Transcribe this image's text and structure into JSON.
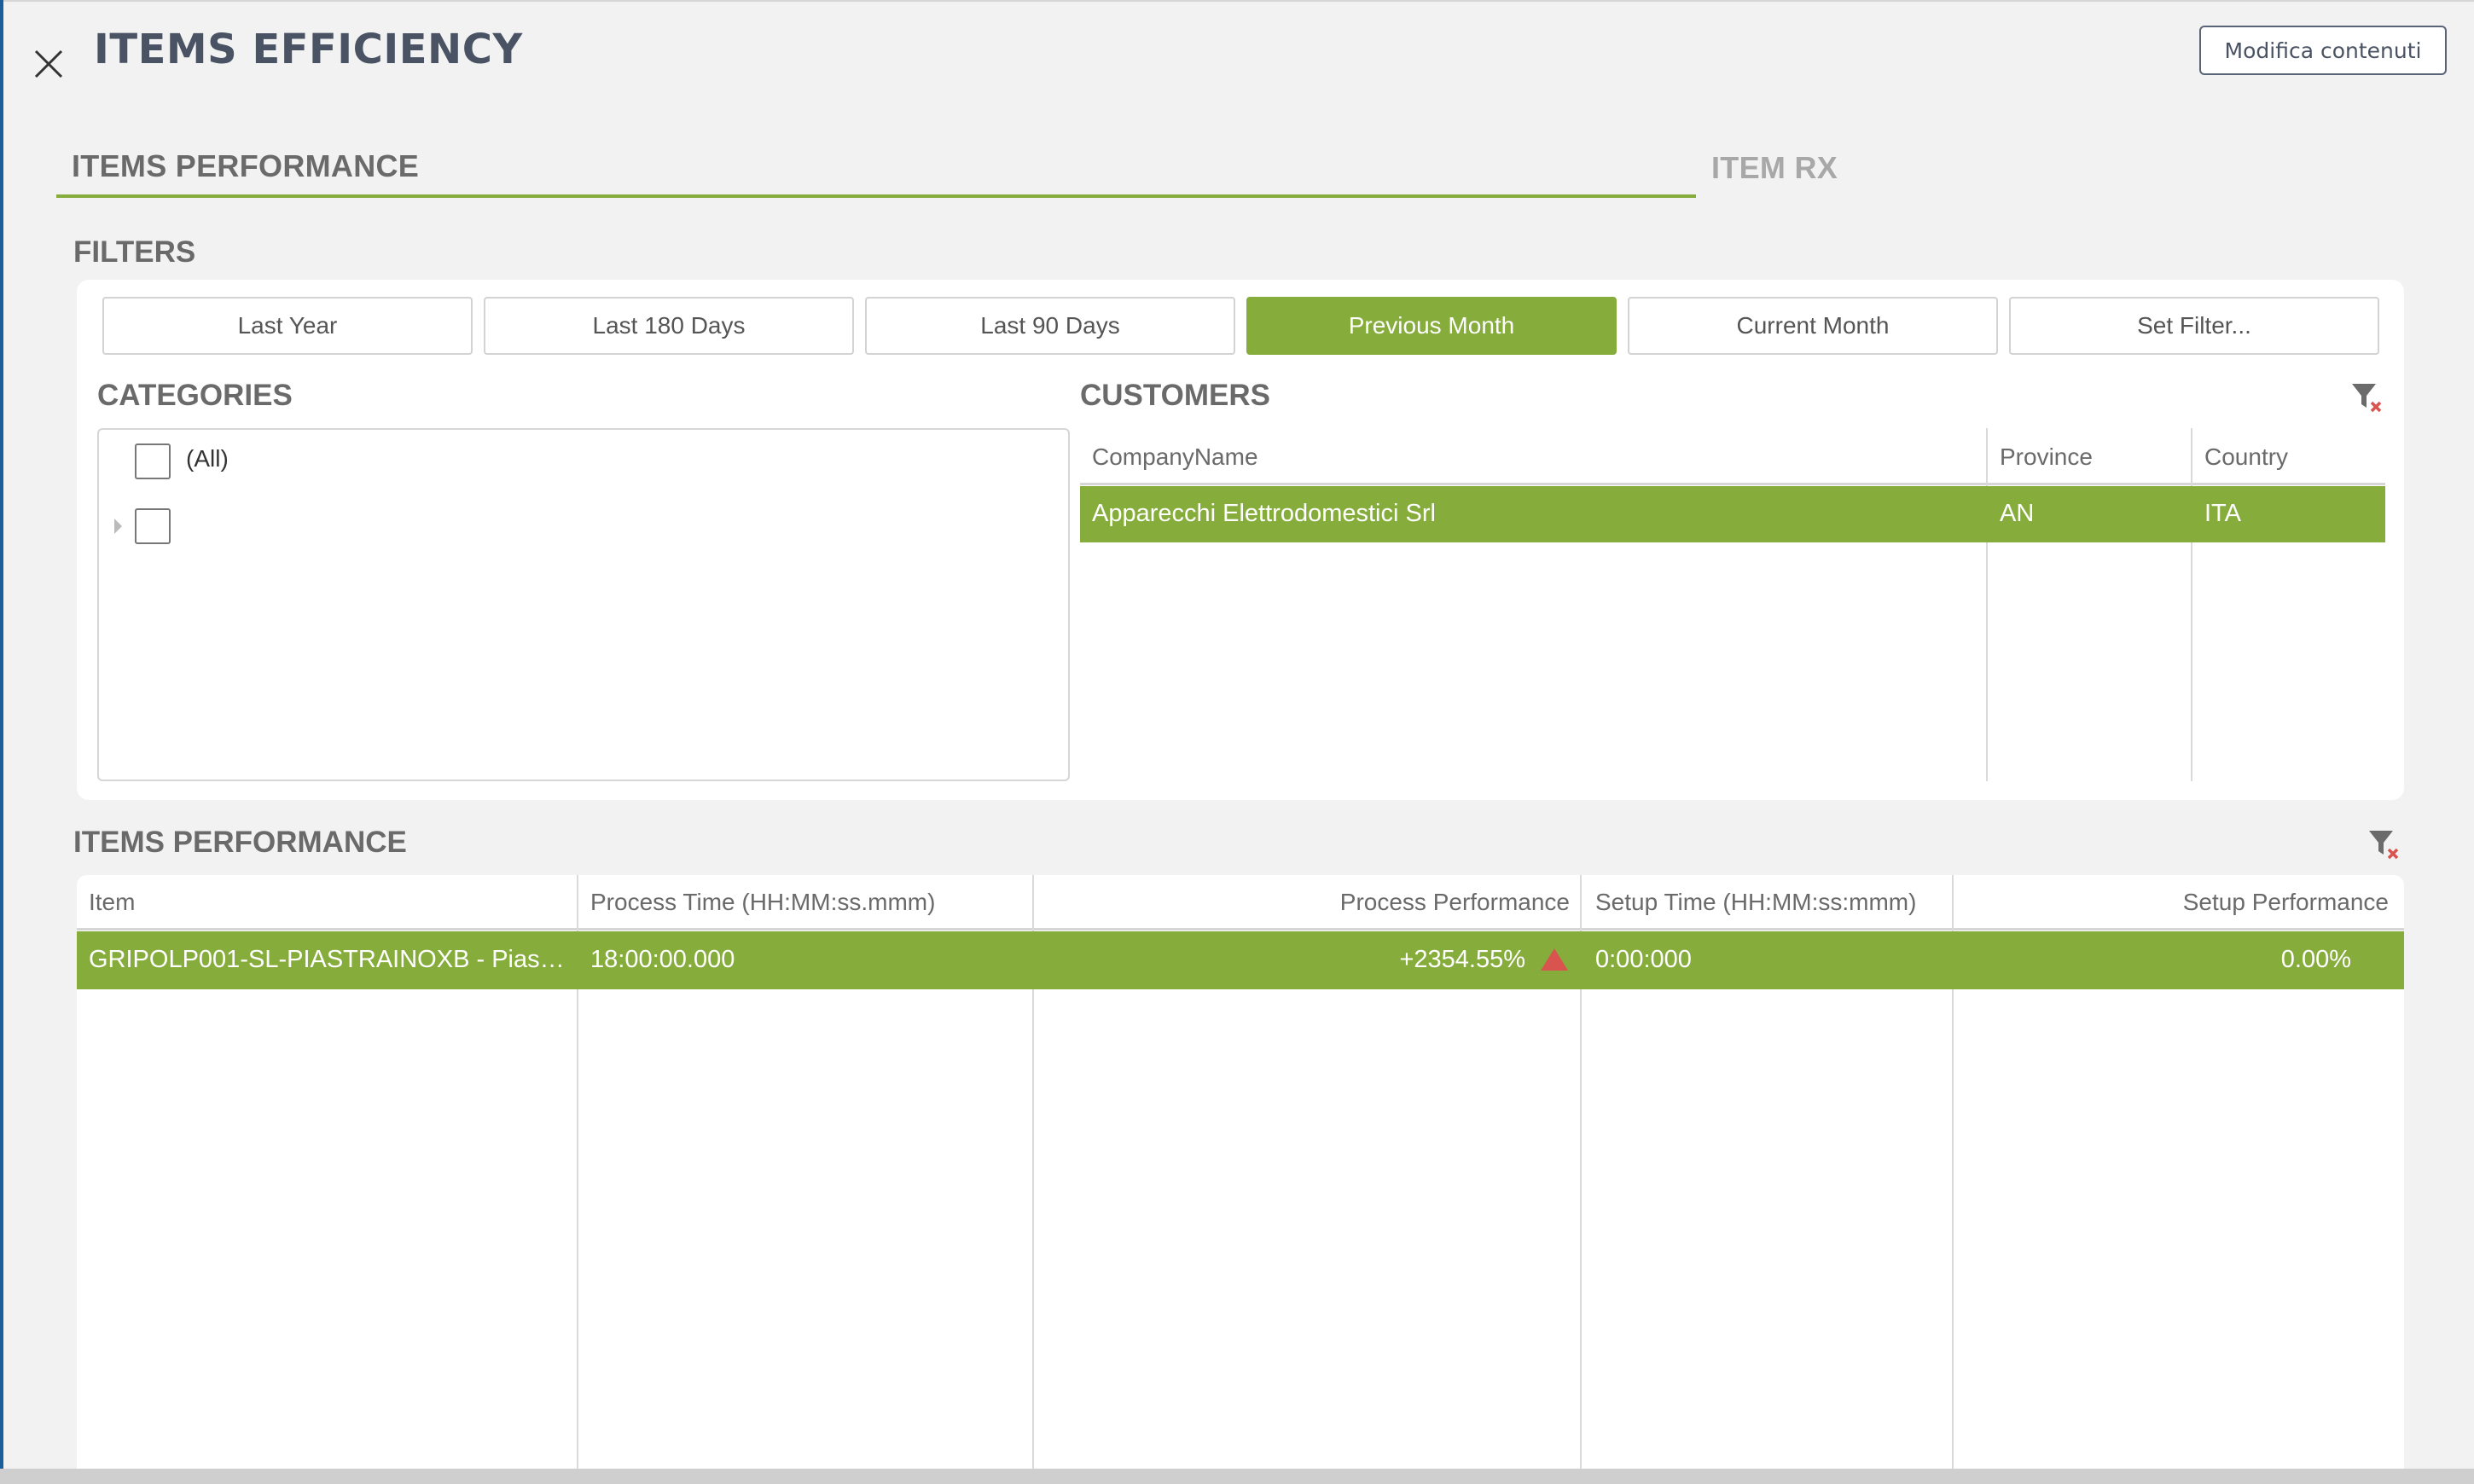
{
  "dialog": {
    "title": "ITEMS EFFICIENCY",
    "edit_button": "Modifica contenuti"
  },
  "tabs": [
    {
      "label": "ITEMS PERFORMANCE",
      "active": true
    },
    {
      "label": "ITEM RX",
      "active": false
    }
  ],
  "filters": {
    "title": "FILTERS",
    "ranges": [
      "Last Year",
      "Last 180 Days",
      "Last 90 Days",
      "Previous Month",
      "Current Month",
      "Set Filter..."
    ],
    "selected_range": "Previous Month",
    "categories": {
      "title": "CATEGORIES",
      "items": [
        {
          "label": "(All)",
          "checked": false
        },
        {
          "label": "",
          "checked": false,
          "expandable": true
        }
      ]
    },
    "customers": {
      "title": "CUSTOMERS",
      "columns": [
        "CompanyName",
        "Province",
        "Country"
      ],
      "rows": [
        {
          "company": "Apparecchi Elettrodomestici Srl",
          "province": "AN",
          "country": "ITA",
          "selected": true
        }
      ]
    }
  },
  "performance": {
    "title": "ITEMS PERFORMANCE",
    "columns": [
      "Item",
      "Process Time (HH:MM:ss.mmm)",
      "Process Performance",
      "Setup Time (HH:MM:ss:mmm)",
      "Setup Performance"
    ],
    "rows": [
      {
        "item": "GRIPOLP001-SL-PIASTRAINOXB - Piastr…",
        "process_time": "18:00:00.000",
        "process_performance": "+2354.55%",
        "trend": "up-triangle-icon",
        "setup_time": "0:00:000",
        "setup_performance": "0.00%",
        "selected": true
      }
    ]
  },
  "colors": {
    "accent": "#86ad3c",
    "trend_indicator": "#d9534f",
    "title": "#4a5363"
  }
}
